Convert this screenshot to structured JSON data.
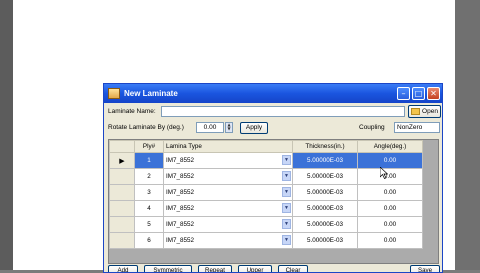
{
  "window": {
    "title": "New Laminate"
  },
  "form": {
    "laminate_name_label": "Laminate Name:",
    "laminate_name_value": "",
    "open_label": "Open",
    "rotate_label": "Rotate Laminate By (deg.)",
    "rotate_value": "0.00",
    "apply_label": "Apply",
    "coupling_label": "Coupling",
    "coupling_value": "NonZero"
  },
  "table": {
    "columns": [
      "Ply#",
      "Lamina Type",
      "Thickness(in.)",
      "Angle(deg.)"
    ],
    "rows": [
      {
        "ply": "1",
        "type": "IM7_8552",
        "thickness": "5.00000E-03",
        "angle": "0.00"
      },
      {
        "ply": "2",
        "type": "IM7_8552",
        "thickness": "5.00000E-03",
        "angle": "0.00"
      },
      {
        "ply": "3",
        "type": "IM7_8552",
        "thickness": "5.00000E-03",
        "angle": "0.00"
      },
      {
        "ply": "4",
        "type": "IM7_8552",
        "thickness": "5.00000E-03",
        "angle": "0.00"
      },
      {
        "ply": "5",
        "type": "IM7_8552",
        "thickness": "5.00000E-03",
        "angle": "0.00"
      },
      {
        "ply": "6",
        "type": "IM7_8552",
        "thickness": "5.00000E-03",
        "angle": "0.00"
      }
    ],
    "selected_row": 0
  },
  "bottom_buttons": [
    "Add",
    "Symmetric",
    "Repeat",
    "Upper",
    "Clear",
    "Save"
  ],
  "colors": {
    "title_bar": "#1a55df",
    "selection": "#3b72d8",
    "dialog_bg": "#ece9d8"
  },
  "icons": {
    "window": "laminate-window-icon",
    "open": "folder-icon",
    "row_pointer": "row-pointer-icon",
    "dropdown": "chevron-down-icon"
  }
}
